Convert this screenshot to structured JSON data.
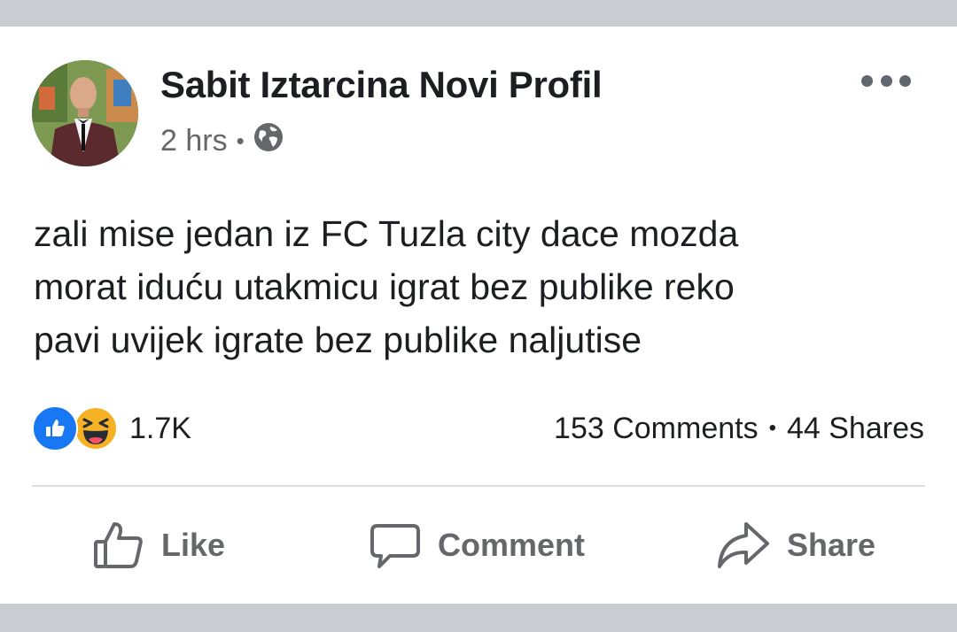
{
  "post": {
    "author": "Sabit Iztarcina Novi Profil",
    "time": "2 hrs",
    "separator": "•",
    "privacy_icon": "globe-icon",
    "text_lines": [
      "zali mise jedan iz FC Tuzla city dace mozda",
      "morat iduću utakmicu igrat bez publike reko",
      "pavi uvijek igrate bez publike naljutise"
    ]
  },
  "reactions": {
    "icons": [
      "like-reaction-icon",
      "haha-reaction-icon"
    ],
    "count": "1.7K"
  },
  "stats": {
    "comments": "153 Comments",
    "separator": "•",
    "shares": "44 Shares"
  },
  "actions": {
    "like": "Like",
    "comment": "Comment",
    "share": "Share"
  },
  "colors": {
    "like_blue": "#1877f2",
    "haha_yellow": "#f7b125",
    "muted_text": "#65676b",
    "band_gray": "#c9ccd1"
  }
}
